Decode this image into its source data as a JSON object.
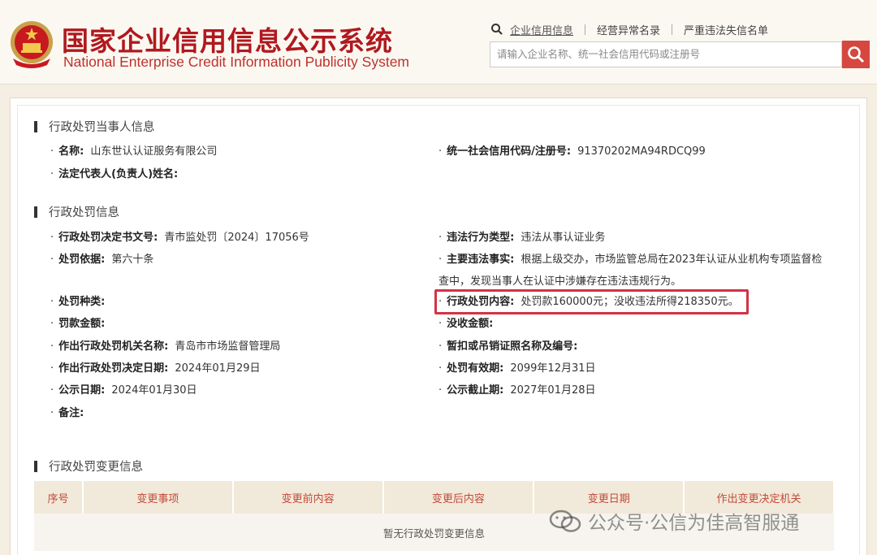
{
  "header": {
    "title_cn": "国家企业信用信息公示系统",
    "title_en": "National Enterprise Credit Information Publicity System",
    "nav": {
      "credit_info": "企业信用信息",
      "abnormal_list": "经营异常名录",
      "serious_list": "严重违法失信名单"
    },
    "search_placeholder": "请输入企业名称、统一社会信用代码或注册号",
    "colors": {
      "brand_red": "#b0191e",
      "search_button": "#d6473f",
      "highlight_border": "#d23344"
    }
  },
  "section_party": {
    "title": "行政处罚当事人信息",
    "name_label": "名称:",
    "name_value": "山东世认认证服务有限公司",
    "credit_code_label": "统一社会信用代码/注册号:",
    "credit_code_value": "91370202MA94RDCQ99",
    "legal_rep_label": "法定代表人(负责人)姓名:",
    "legal_rep_value": ""
  },
  "section_penalty": {
    "title": "行政处罚信息",
    "doc_no_label": "行政处罚决定书文号:",
    "doc_no_value": "青市监处罚〔2024〕17056号",
    "violation_type_label": "违法行为类型:",
    "violation_type_value": "违法从事认证业务",
    "basis_label": "处罚依据:",
    "basis_value": "第六十条",
    "facts_label": "主要违法事实:",
    "facts_value": "根据上级交办，市场监管总局在2023年认证从业机构专项监督检查中，发现当事人在认证中涉嫌存在违法违规行为。",
    "penalty_kind_label": "处罚种类:",
    "penalty_kind_value": "",
    "penalty_content_label": "行政处罚内容:",
    "penalty_content_value": "处罚款160000元；没收违法所得218350元。",
    "fine_amount_label": "罚款金额:",
    "fine_amount_value": "",
    "confiscation_label": "没收金额:",
    "confiscation_value": "",
    "authority_label": "作出行政处罚机关名称:",
    "authority_value": "青岛市市场监督管理局",
    "license_label": "暂扣或吊销证照名称及编号:",
    "license_value": "",
    "decision_date_label": "作出行政处罚决定日期:",
    "decision_date_value": "2024年01月29日",
    "validity_label": "处罚有效期:",
    "validity_value": "2099年12月31日",
    "publish_date_label": "公示日期:",
    "publish_date_value": "2024年01月30日",
    "publish_end_label": "公示截止期:",
    "publish_end_value": "2027年01月28日",
    "remark_label": "备注:",
    "remark_value": ""
  },
  "section_change": {
    "title": "行政处罚变更信息",
    "columns": [
      "序号",
      "变更事项",
      "变更前内容",
      "变更后内容",
      "变更日期",
      "作出变更决定机关"
    ],
    "empty_text": "暂无行政处罚变更信息"
  },
  "watermark": "公众号·公信为佳高智服通"
}
